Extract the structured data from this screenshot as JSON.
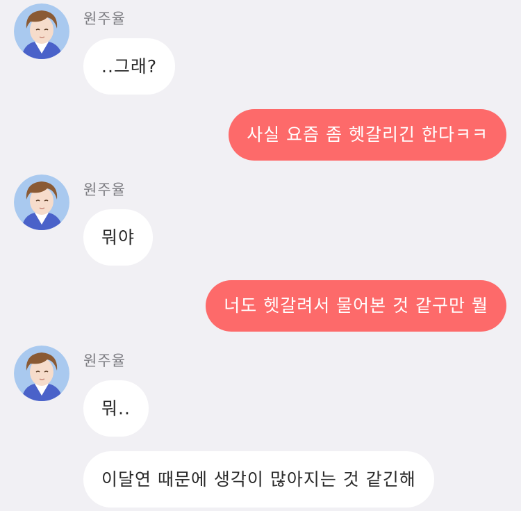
{
  "colors": {
    "background": "#f1f0f4",
    "incoming_bubble": "#ffffff",
    "outgoing_bubble": "#fd6a6a",
    "sender_name": "#7b7b80"
  },
  "messages": [
    {
      "type": "incoming",
      "sender": "원주율",
      "avatar": "avatar-icon",
      "text": "..그래?"
    },
    {
      "type": "outgoing",
      "text": "사실 요즘 좀 헷갈리긴 한다ㅋㅋ"
    },
    {
      "type": "incoming",
      "sender": "원주율",
      "avatar": "avatar-icon",
      "text": "뭐야"
    },
    {
      "type": "outgoing",
      "text": "너도 헷갈려서 물어본 것 같구만 뭘"
    },
    {
      "type": "incoming",
      "sender": "원주율",
      "avatar": "avatar-icon",
      "text": "뭐.."
    },
    {
      "type": "incoming-continued",
      "text": "이달연 때문에 생각이 많아지는 것 같긴해"
    }
  ]
}
